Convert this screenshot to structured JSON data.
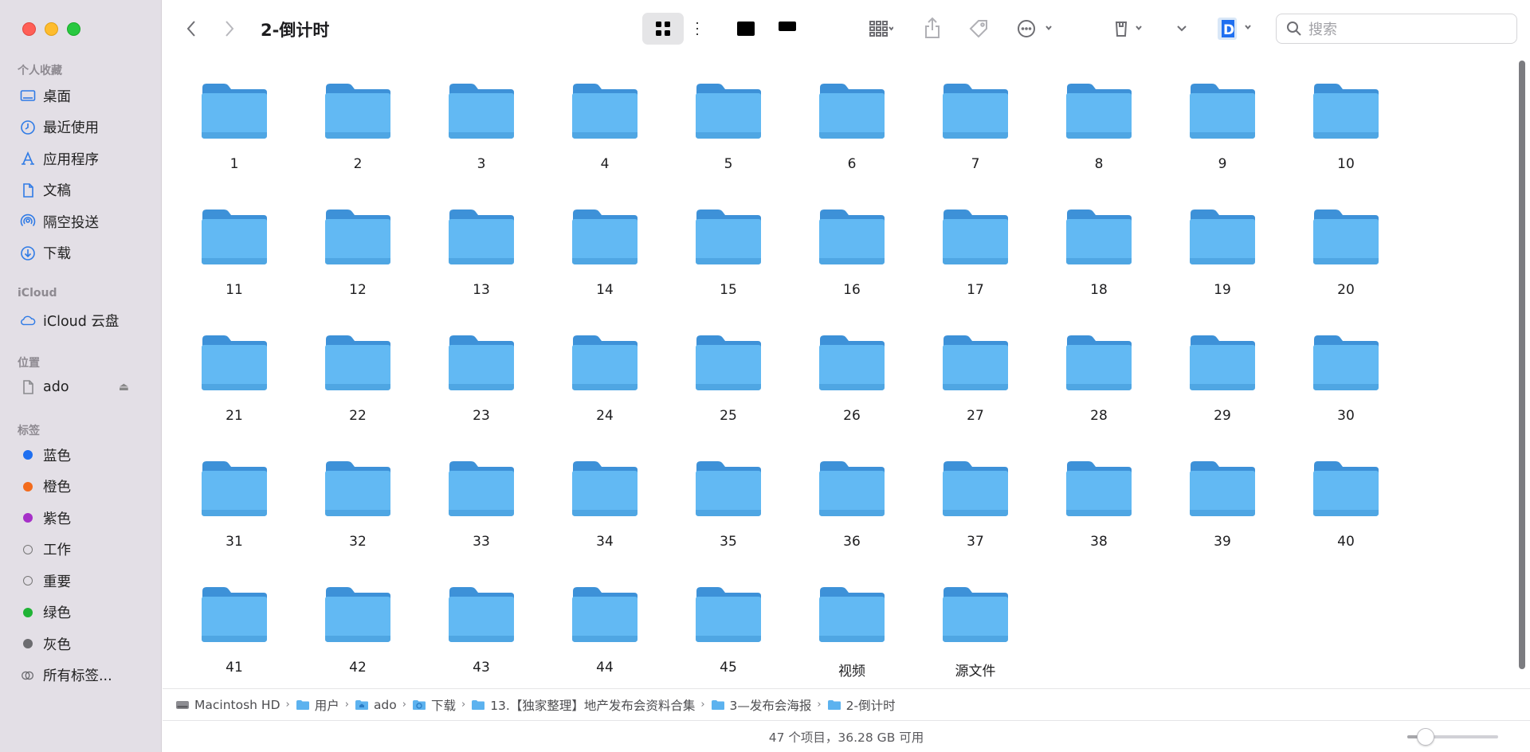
{
  "window": {
    "title": "2-倒计时"
  },
  "sidebar": {
    "favorites_title": "个人收藏",
    "favorites": [
      {
        "label": "桌面",
        "icon": "desktop-icon"
      },
      {
        "label": "最近使用",
        "icon": "clock-icon"
      },
      {
        "label": "应用程序",
        "icon": "applications-icon"
      },
      {
        "label": "文稿",
        "icon": "document-icon"
      },
      {
        "label": "隔空投送",
        "icon": "airdrop-icon"
      },
      {
        "label": "下载",
        "icon": "download-icon"
      }
    ],
    "icloud_title": "iCloud",
    "icloud": [
      {
        "label": "iCloud 云盘",
        "icon": "cloud-icon"
      }
    ],
    "locations_title": "位置",
    "locations": [
      {
        "label": "ado",
        "icon": "drive-icon"
      }
    ],
    "tags_title": "标签",
    "tags": [
      {
        "label": "蓝色",
        "color": "#1f6ff0"
      },
      {
        "label": "橙色",
        "color": "#f36b1c"
      },
      {
        "label": "紫色",
        "color": "#a630c8"
      },
      {
        "label": "工作",
        "color": ""
      },
      {
        "label": "重要",
        "color": ""
      },
      {
        "label": "绿色",
        "color": "#20b335"
      },
      {
        "label": "灰色",
        "color": "#6c6c70"
      },
      {
        "label": "所有标签...",
        "color": "all"
      }
    ]
  },
  "toolbar": {
    "search_placeholder": "搜索",
    "active_view": "icon-view"
  },
  "items": [
    "1",
    "2",
    "3",
    "4",
    "5",
    "6",
    "7",
    "8",
    "9",
    "10",
    "11",
    "12",
    "13",
    "14",
    "15",
    "16",
    "17",
    "18",
    "19",
    "20",
    "21",
    "22",
    "23",
    "24",
    "25",
    "26",
    "27",
    "28",
    "29",
    "30",
    "31",
    "32",
    "33",
    "34",
    "35",
    "36",
    "37",
    "38",
    "39",
    "40",
    "41",
    "42",
    "43",
    "44",
    "45",
    "视频",
    "源文件"
  ],
  "pathbar": [
    {
      "label": "Macintosh HD",
      "icon": "harddrive-icon"
    },
    {
      "label": "用户",
      "icon": "folder-icon"
    },
    {
      "label": "ado",
      "icon": "home-folder-icon"
    },
    {
      "label": "下载",
      "icon": "download-folder-icon"
    },
    {
      "label": "13.【独家整理】地产发布会资料合集",
      "icon": "folder-icon"
    },
    {
      "label": "3—发布会海报",
      "icon": "folder-icon"
    },
    {
      "label": "2-倒计时",
      "icon": "folder-icon"
    }
  ],
  "status": {
    "text": "47 个项目，36.28 GB 可用",
    "icon_size_level": 0.2
  },
  "colors": {
    "folder_body": "#62b9f3",
    "folder_tab": "#3d91d8",
    "accent": "#2f7be6"
  }
}
